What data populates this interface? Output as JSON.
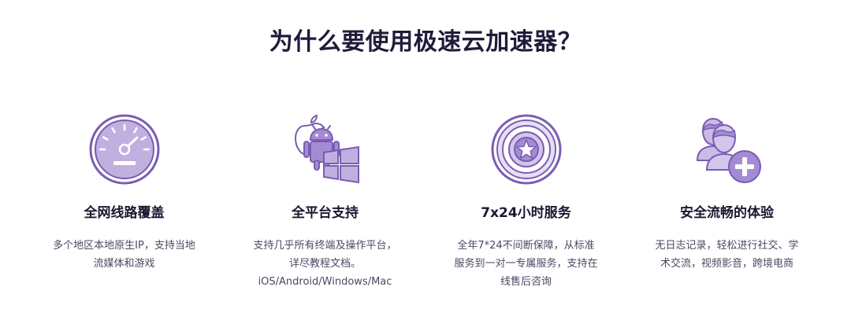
{
  "heading": "为什么要使用极速云加速器？",
  "features": [
    {
      "icon": "speedometer-icon",
      "title": "全网线路覆盖",
      "desc_lines": [
        "多个地区本地原生IP，支持当地",
        "流媒体和游戏"
      ]
    },
    {
      "icon": "platforms-icon",
      "title": "全平台支持",
      "desc_lines": [
        "支持几乎所有终端及操作平台，",
        "详尽教程文档。",
        "iOS/Android/Windows/Mac"
      ]
    },
    {
      "icon": "shield-star-icon",
      "title": "7x24小时服务",
      "desc_lines": [
        "全年7*24不间断保障，从标准",
        "服务到一对一专属服务，支持在",
        "线售后咨询"
      ]
    },
    {
      "icon": "users-plus-icon",
      "title": "安全流畅的体验",
      "desc_lines": [
        "无日志记录，轻松进行社交、学",
        "术交流，视频影音，跨境电商"
      ]
    }
  ],
  "colors": {
    "primary_purple": "#7a5cb3",
    "light_purple": "#c9bbe6",
    "pale_purple": "#e9e3f5",
    "heading": "#221a3a",
    "body_text": "#4d4862"
  }
}
